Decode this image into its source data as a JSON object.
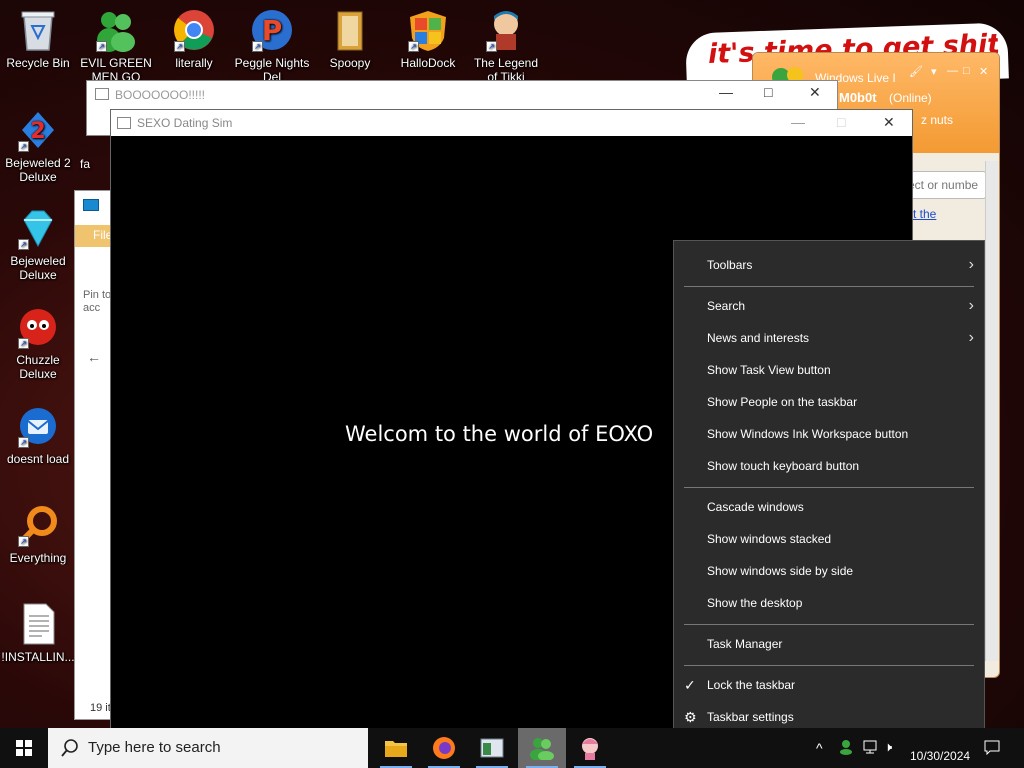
{
  "desktop": {
    "icons": [
      {
        "label": "Recycle Bin"
      },
      {
        "label": "EVIL GREEN MEN GO"
      },
      {
        "label": "literally"
      },
      {
        "label": "Peggle Nights Del"
      },
      {
        "label": "Spoopy"
      },
      {
        "label": "HalloDock"
      },
      {
        "label": "The Legend of Tikki"
      },
      {
        "label": "Bejeweled 2 Deluxe"
      },
      {
        "label": "Bejeweled Deluxe"
      },
      {
        "label": "Chuzzle Deluxe"
      },
      {
        "label": "doesnt load"
      },
      {
        "label": "Everything"
      },
      {
        "label": "!INSTALLIN..."
      }
    ],
    "partial_icon_label": "fa"
  },
  "messenger": {
    "banner": "it's time to get shit",
    "title": "Windows Live I",
    "username": "M0b0t",
    "status": "(Online)",
    "personal_message": "z nuts",
    "search_placeholder": "ect or numbe",
    "link": "t the"
  },
  "explorer": {
    "file_tab": "File",
    "pin_label": "Pin to qu acc",
    "footer": "19 it"
  },
  "window_boo": {
    "title": "BOOOOOOO!!!!!"
  },
  "window_sexo": {
    "title": "SEXO Dating Sim",
    "body_text": "Welcom to the world of EOXO"
  },
  "context_menu": {
    "items": [
      {
        "label": "Toolbars",
        "submenu": true
      },
      {
        "label": "Search",
        "submenu": true
      },
      {
        "label": "News and interests",
        "submenu": true
      },
      {
        "label": "Show Task View button"
      },
      {
        "label": "Show People on the taskbar"
      },
      {
        "label": "Show Windows Ink Workspace button"
      },
      {
        "label": "Show touch keyboard button"
      },
      {
        "label": "Cascade windows"
      },
      {
        "label": "Show windows stacked"
      },
      {
        "label": "Show windows side by side"
      },
      {
        "label": "Show the desktop"
      },
      {
        "label": "Task Manager"
      },
      {
        "label": "Lock the taskbar",
        "checked": true
      },
      {
        "label": "Taskbar settings",
        "icon": "gear-icon"
      }
    ]
  },
  "taskbar": {
    "search_placeholder": "Type here to search",
    "apps": [
      "file-explorer",
      "firefox",
      "system-window",
      "messenger",
      "anime-character"
    ],
    "clock_date": "10/30/2024",
    "accent": "#7ab0f0"
  }
}
